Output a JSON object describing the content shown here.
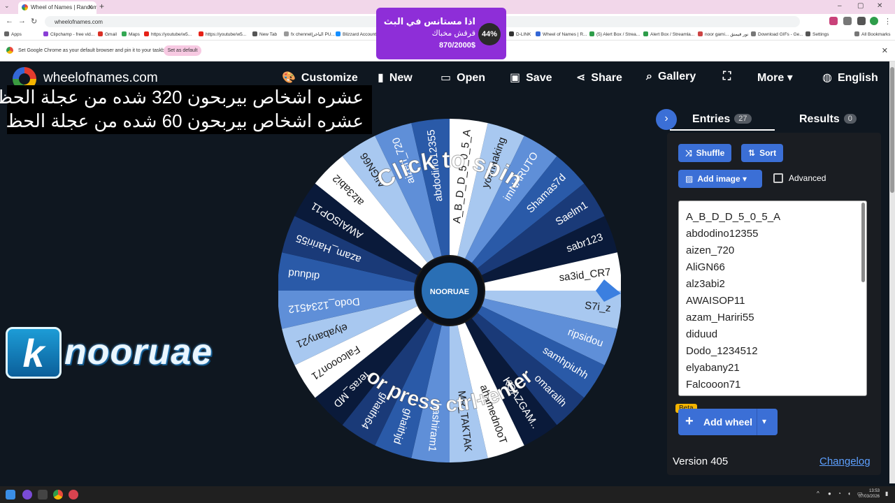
{
  "browser": {
    "tab_title": "Wheel of Names | Random na...",
    "url": "wheelofnames.com",
    "bookmarks": [
      "Apps",
      "Clipchamp - free vid...",
      "Gmail",
      "Maps",
      "https://youtube/w5...",
      "https://youtube/w5...",
      "New Tab",
      "fx chennel|الباخر PU...",
      "Blizzard Account",
      "D-LINK",
      "Wheel of Names | R...",
      "(5) Alert Box / Strea...",
      "Alert Box / Streamla...",
      "noor gami... نور قيمنق",
      "Download GIFs - Ge...",
      "Settings",
      "All Bookmarks"
    ],
    "info_message": "Set Google Chrome as your default browser and pin it to your taskbar",
    "set_default_label": "Set as default"
  },
  "donation": {
    "line1": "اذا مستانس في البث",
    "line2": "قرقش مخباك",
    "amount": "870/2000$",
    "percent": "44%",
    "percent_value": 44
  },
  "header": {
    "site_name": "wheelofnames.com",
    "menu": {
      "customize": "Customize",
      "new": "New",
      "open": "Open",
      "save": "Save",
      "share": "Share",
      "gallery": "Gallery",
      "more": "More",
      "language": "English"
    }
  },
  "overlay_text": {
    "line1": "عشره اشخاص بيربحون 320 شده من عجلة الحظ",
    "line2": "عشره اشخاص بيربحون 60 شده من عجلة الحظ"
  },
  "brand_logo": {
    "k": "k",
    "rest": "nooruae"
  },
  "wheel": {
    "click_text": "Click to spin",
    "press_text": "or press ctrl+enter",
    "center_logo": "NOORUAE",
    "colors": [
      "#ffffff",
      "#a8c8f0",
      "#5f8fd8",
      "#2a5aa8",
      "#1a3a78",
      "#0a1a3a"
    ],
    "segments": [
      "A_B_D_D_5_0_5_A",
      "yoshaaking",
      "imNARUTO",
      "Shamas7d",
      "Saelm1",
      "sabr123",
      "sa3id_CR7",
      "S7i_z",
      "ripsidou",
      "samhpiuhh",
      "omaralih",
      "KOAZGAM..",
      "ahamedn0oT",
      "MR_TAKTAK",
      "hashiram1",
      "ghaithjd",
      "ghaith64",
      "feras_MD",
      "Falcooon71",
      "elyabany21",
      "Dodo_1234512",
      "diduud",
      "azam_Hariri55",
      "AWAISOP11",
      "alz3abi2",
      "AliGN66",
      "aizen_720",
      "abdodino12355"
    ]
  },
  "panel": {
    "tab_entries": "Entries",
    "entries_count": "27",
    "tab_results": "Results",
    "results_count": "0",
    "shuffle": "Shuffle",
    "sort": "Sort",
    "add_image": "Add image",
    "advanced": "Advanced",
    "entries": [
      "A_B_D_D_5_0_5_A",
      "abdodino12355",
      "aizen_720",
      "AliGN66",
      "alz3abi2",
      "AWAISOP11",
      "azam_Hariri55",
      "diduud",
      "Dodo_1234512",
      "elyabany21",
      "Falcooon71"
    ],
    "beta": "Beta",
    "add_wheel": "Add wheel",
    "version": "Version 405",
    "changelog": "Changelog"
  },
  "taskbar": {
    "time": "13:53",
    "date": "07/03/2026"
  }
}
